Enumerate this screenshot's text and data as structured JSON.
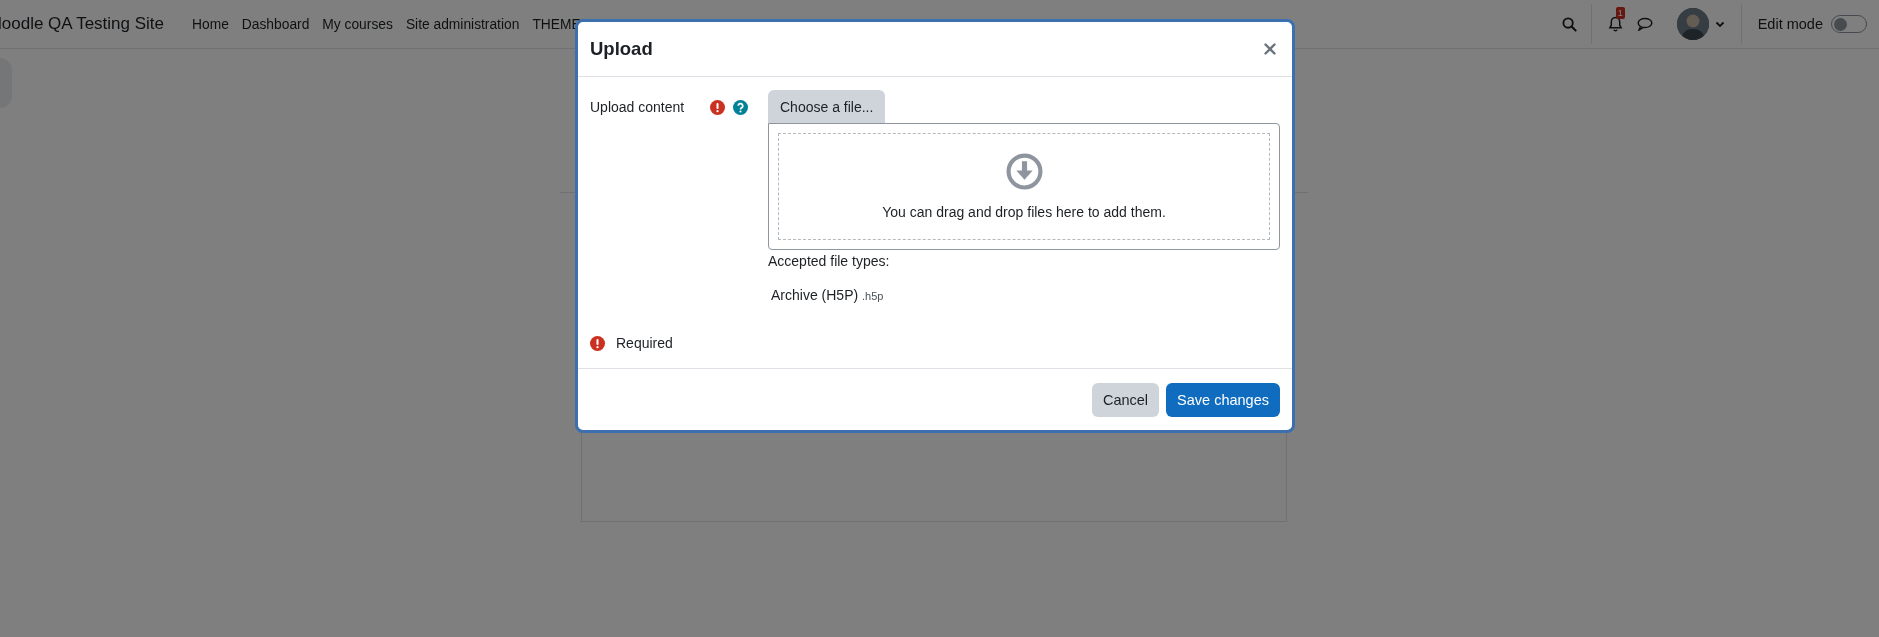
{
  "navbar": {
    "site_name": "loodle QA Testing Site",
    "links": [
      {
        "label": "Home"
      },
      {
        "label": "Dashboard"
      },
      {
        "label": "My courses"
      },
      {
        "label": "Site administration"
      },
      {
        "label": "THEME"
      }
    ],
    "notification_count": "1",
    "edit_mode": {
      "label": "Edit mode",
      "on": false
    }
  },
  "dialog": {
    "title": "Upload",
    "field": {
      "label": "Upload content",
      "required": true,
      "choose_button": "Choose a file...",
      "drop_hint": "You can drag and drop files here to add them.",
      "accepted_label": "Accepted file types:",
      "file_types": [
        {
          "name": "Archive (H5P)",
          "extension": ".h5p"
        }
      ]
    },
    "required_note": "Required",
    "buttons": [
      {
        "label": "Cancel",
        "kind": "secondary"
      },
      {
        "label": "Save changes",
        "kind": "primary"
      }
    ]
  }
}
